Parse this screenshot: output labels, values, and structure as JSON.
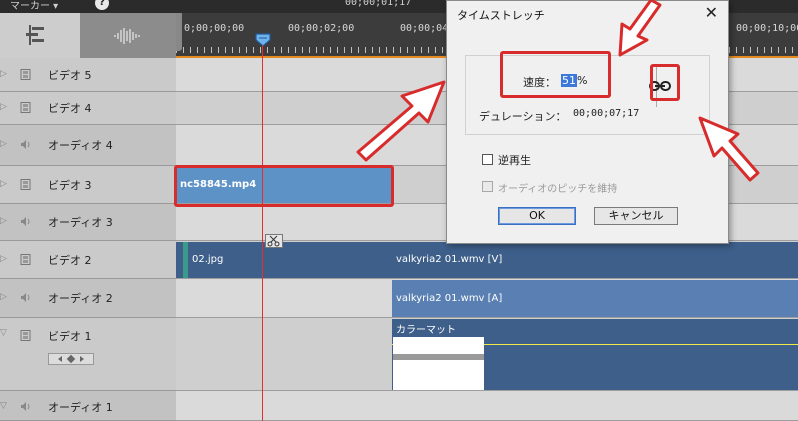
{
  "topbar": {
    "marker_label": "マーカー ▾",
    "help_label": "?",
    "time": "00;00;01;17"
  },
  "ruler": {
    "labels": [
      "0;00;00;00",
      "00;00;02;00",
      "00;00;04",
      "00;00;10;00"
    ]
  },
  "tracks": [
    {
      "label": "ビデオ 5",
      "kind": "video"
    },
    {
      "label": "ビデオ 4",
      "kind": "video"
    },
    {
      "label": "オーディオ 4",
      "kind": "audio"
    },
    {
      "label": "ビデオ 3",
      "kind": "video"
    },
    {
      "label": "オーディオ 3",
      "kind": "audio"
    },
    {
      "label": "ビデオ 2",
      "kind": "video"
    },
    {
      "label": "オーディオ 2",
      "kind": "audio"
    },
    {
      "label": "ビデオ 1",
      "kind": "video"
    },
    {
      "label": "オーディオ 1",
      "kind": "audio"
    }
  ],
  "clips": {
    "nc": "nc58845.mp4",
    "jpg": "02.jpg",
    "valk_v": "valkyria2 01.wmv [V]",
    "valk_a": "valkyria2 01.wmv [A]",
    "color": "カラーマット"
  },
  "dialog": {
    "title": "タイムストレッチ",
    "close": "✕",
    "speed_label": "速度：",
    "speed_value": "51",
    "speed_unit": "%",
    "duration_label": "デュレーション：",
    "duration_value": "00;00;07;17",
    "reverse_label": "逆再生",
    "pitch_label": "オーディオのピッチを維持",
    "ok": "OK",
    "cancel": "キャンセル"
  },
  "colors": {
    "annotation": "#d82b2b",
    "clip_blue": "#3d5f8a",
    "clip_selected": "#5c92c6",
    "timeline_orange": "#e58a1f"
  },
  "icons": [
    "help-icon",
    "track-list-icon",
    "audio-waveform-icon",
    "film-icon",
    "speaker-icon",
    "scissors-icon",
    "link-icon",
    "close-icon",
    "playhead-icon"
  ]
}
